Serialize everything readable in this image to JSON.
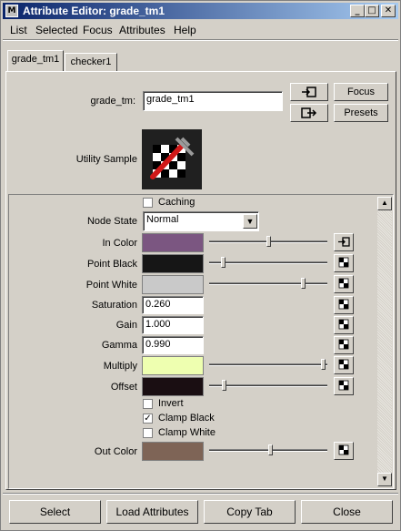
{
  "window": {
    "title": "Attribute Editor: grade_tm1",
    "minimize": "_",
    "maximize": "□",
    "close": "✕"
  },
  "menu": [
    "List",
    "Selected",
    "Focus",
    "Attributes",
    "Help"
  ],
  "tabs": [
    "grade_tm1",
    "checker1"
  ],
  "node": {
    "name_label": "grade_tm:",
    "name_value": "grade_tm1",
    "focus_button": "Focus",
    "presets_button": "Presets",
    "sample_label": "Utility Sample"
  },
  "attributes": {
    "caching_label": "Caching",
    "caching_checked": false,
    "node_state_label": "Node State",
    "node_state_value": "Normal",
    "in_color_label": "In Color",
    "in_color": "#7b5681",
    "in_color_slider": 0.5,
    "point_black_label": "Point Black",
    "point_black_color": "#161616",
    "point_black_slider": 0.1,
    "point_white_label": "Point White",
    "point_white_color": "#c9c9c9",
    "point_white_slider": 0.81,
    "saturation_label": "Saturation",
    "saturation_value": "0.260",
    "gain_label": "Gain",
    "gain_value": "1.000",
    "gamma_label": "Gamma",
    "gamma_value": "0.990",
    "multiply_label": "Multiply",
    "multiply_color": "#eeffb0",
    "multiply_slider": 0.98,
    "offset_label": "Offset",
    "offset_color": "#1a0e12",
    "offset_slider": 0.11,
    "invert_label": "Invert",
    "invert_checked": false,
    "clamp_black_label": "Clamp Black",
    "clamp_black_checked": true,
    "clamp_white_label": "Clamp White",
    "clamp_white_checked": false,
    "out_color_label": "Out Color",
    "out_color": "#7e6456",
    "out_color_slider": 0.52
  },
  "bottom_buttons": {
    "select": "Select",
    "load": "Load Attributes",
    "copy_tab": "Copy Tab",
    "close": "Close"
  }
}
